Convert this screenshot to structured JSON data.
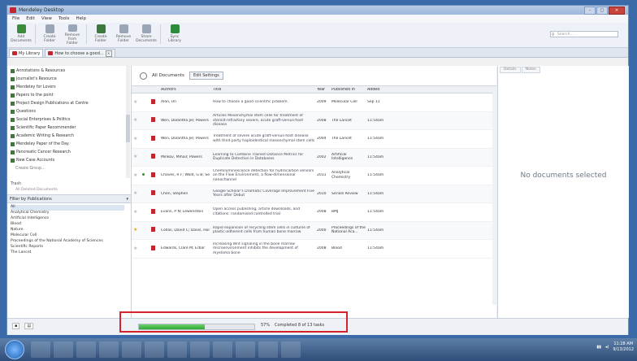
{
  "window": {
    "title": "Mendeley Desktop"
  },
  "menu": [
    "File",
    "Edit",
    "View",
    "Tools",
    "Help"
  ],
  "toolbar": {
    "buttons": [
      {
        "label": "Add\nDocuments",
        "icon": "add-documents-icon",
        "color": "#3b8a3b"
      },
      {
        "label": "Create\nFolder",
        "icon": "folder-icon",
        "color": "#9aa6b6"
      },
      {
        "label": "Remove from\nFolder",
        "icon": "remove-folder-icon",
        "color": "#9aa6b6"
      },
      {
        "label": "Create\nFolder",
        "icon": "new-folder-icon",
        "color": "#3b7a3b"
      },
      {
        "label": "Remove\nFolder",
        "icon": "delete-folder-icon",
        "color": "#9aa6b6"
      },
      {
        "label": "Share\nDocuments",
        "icon": "share-icon",
        "color": "#9aa6b6"
      },
      {
        "label": "Sync\nLibrary",
        "icon": "sync-icon",
        "color": "#2e8b3c"
      }
    ],
    "search_placeholder": "Search..."
  },
  "tabs": [
    {
      "label": "My Library"
    },
    {
      "label": "How to choose a good..."
    }
  ],
  "sidebar": {
    "items": [
      "Annotations & Resources",
      "Journalist's Resource",
      "Mendeley for Lovers",
      "Papers to the point",
      "Project Design Publications at Centre",
      "Questions",
      "Social Enterprises & Politics",
      "Scientific Paper Recommender",
      "Academic Writing & Research",
      "Mendeley Paper of the Day",
      "Pancreatic Cancer Research",
      "New Case Accounts",
      "Create Group..."
    ],
    "trash": "Trash",
    "trash_sub": "All Deleted Documents",
    "filter_title": "Filter by Publications",
    "filter_items": [
      "All",
      "Analytical Chemistry",
      "Artificial Intelligence",
      "Blood",
      "Nature",
      "Molecular Cell",
      "Proceedings of the National Academy of Sciences",
      "Scientific Reports",
      "The Lancet"
    ]
  },
  "center": {
    "heading": "All Documents",
    "edit_settings": "Edit Settings",
    "columns": [
      "",
      "",
      "",
      "Authors",
      "Title",
      "Year",
      "Published In",
      "Added"
    ],
    "rows": [
      {
        "star": false,
        "read": false,
        "authors": "Alon, Uri",
        "title": "How to choose a good scientific problem.",
        "year": "2009",
        "pub": "Molecular Cell",
        "added": "Sep 11"
      },
      {
        "star": false,
        "read": false,
        "authors": "Wen, Dolantha Jie; Powers",
        "title": "Articles Mesenchymal stem cells for treatment of steroid-refractory severe, acute graft-versus-host disease",
        "year": "2008",
        "pub": "The Lancet",
        "added": "11:54am"
      },
      {
        "star": false,
        "read": false,
        "authors": "Wen, Dolantha Jie; Powers",
        "title": "Treatment of severe acute graft-versus-host disease with third party haploidentical mesenchymal stem cells",
        "year": "2004",
        "pub": "The Lancet",
        "added": "11:54am"
      },
      {
        "star": false,
        "read": false,
        "authors": "Minkov, Mihail; Powers",
        "title": "Learning to Combine Trained Distance Metrics for Duplicate Detection in Databases",
        "year": "2002",
        "pub": "Artificial Intelligence",
        "added": "11:54am"
      },
      {
        "star": false,
        "read": true,
        "authors": "Chaves, R F; Wold, G B; Se",
        "title": "Chemiluminescence detection for hydrocarbon sensors on the Flow Environment, a flow-dimensional nanochannel",
        "year": "2011",
        "pub": "Analytical Chemistry",
        "added": "11:54am"
      },
      {
        "star": false,
        "read": false,
        "authors": "Chen, Stephen",
        "title": "Google Scholar's Dramatic Coverage Improvement Five Years after Debut",
        "year": "2010",
        "pub": "Serials Review",
        "added": "11:54am"
      },
      {
        "star": false,
        "read": false,
        "authors": "Evans, P N; Lewenstein",
        "title": "Open access publishing, article downloads, and citations: randomised controlled trial",
        "year": "2008",
        "pub": "BMJ",
        "added": "11:54am"
      },
      {
        "star": true,
        "read": false,
        "authors": "Collas, David C; Davis, Hor",
        "title": "Rapid expansion of recycling stem cells in cultures of plastic-adherent cells from human bone marrow",
        "year": "2000",
        "pub": "Proceedings of the National Aca...",
        "added": "11:54am"
      },
      {
        "star": false,
        "read": false,
        "authors": "Edwards, Clare M; Erbar",
        "title": "Increasing Wnt signaling in the bone marrow microenvironment inhibits the development of myeloma bone",
        "year": "2008",
        "pub": "Blood",
        "added": "11:54am"
      }
    ]
  },
  "right": {
    "tabs": [
      "Details",
      "Notes"
    ],
    "empty_message": "No documents selected"
  },
  "status": {
    "progress_fraction": 0.57,
    "progress_percent": "57%",
    "task_text": "Completed 8 of 13 tasks",
    "colors": {
      "highlight": "#d6222a",
      "progress": "#2ea72e"
    }
  },
  "taskbar": {
    "apps": [
      "ie-icon",
      "explorer-icon",
      "media-icon",
      "skype-icon",
      "chrome-icon",
      "skype-2-icon",
      "mendeley-icon",
      "paint-icon",
      "snip-icon",
      "excel-icon",
      "word-icon",
      "tool-icon"
    ],
    "time": "11:28 AM",
    "date": "9/13/2012"
  }
}
